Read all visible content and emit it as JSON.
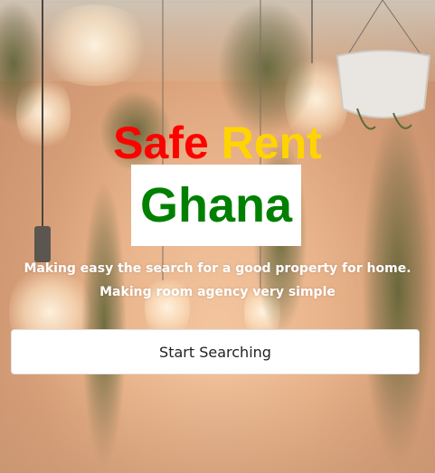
{
  "hero": {
    "title_word1": "Safe",
    "title_word2": "Rent",
    "title_word3": "Ghana",
    "tagline_line1": "Making easy the search for a good property for home.",
    "tagline_line2": "Making room agency very simple",
    "cta_label": "Start Searching"
  },
  "colors": {
    "safe": "#ff0000",
    "rent": "#ffd400",
    "ghana": "#008000",
    "ghana_box": "#ffffff",
    "tagline": "#ffffff"
  },
  "background": {
    "image_subject": "hanging-plants-and-light-bulbs-photo"
  }
}
